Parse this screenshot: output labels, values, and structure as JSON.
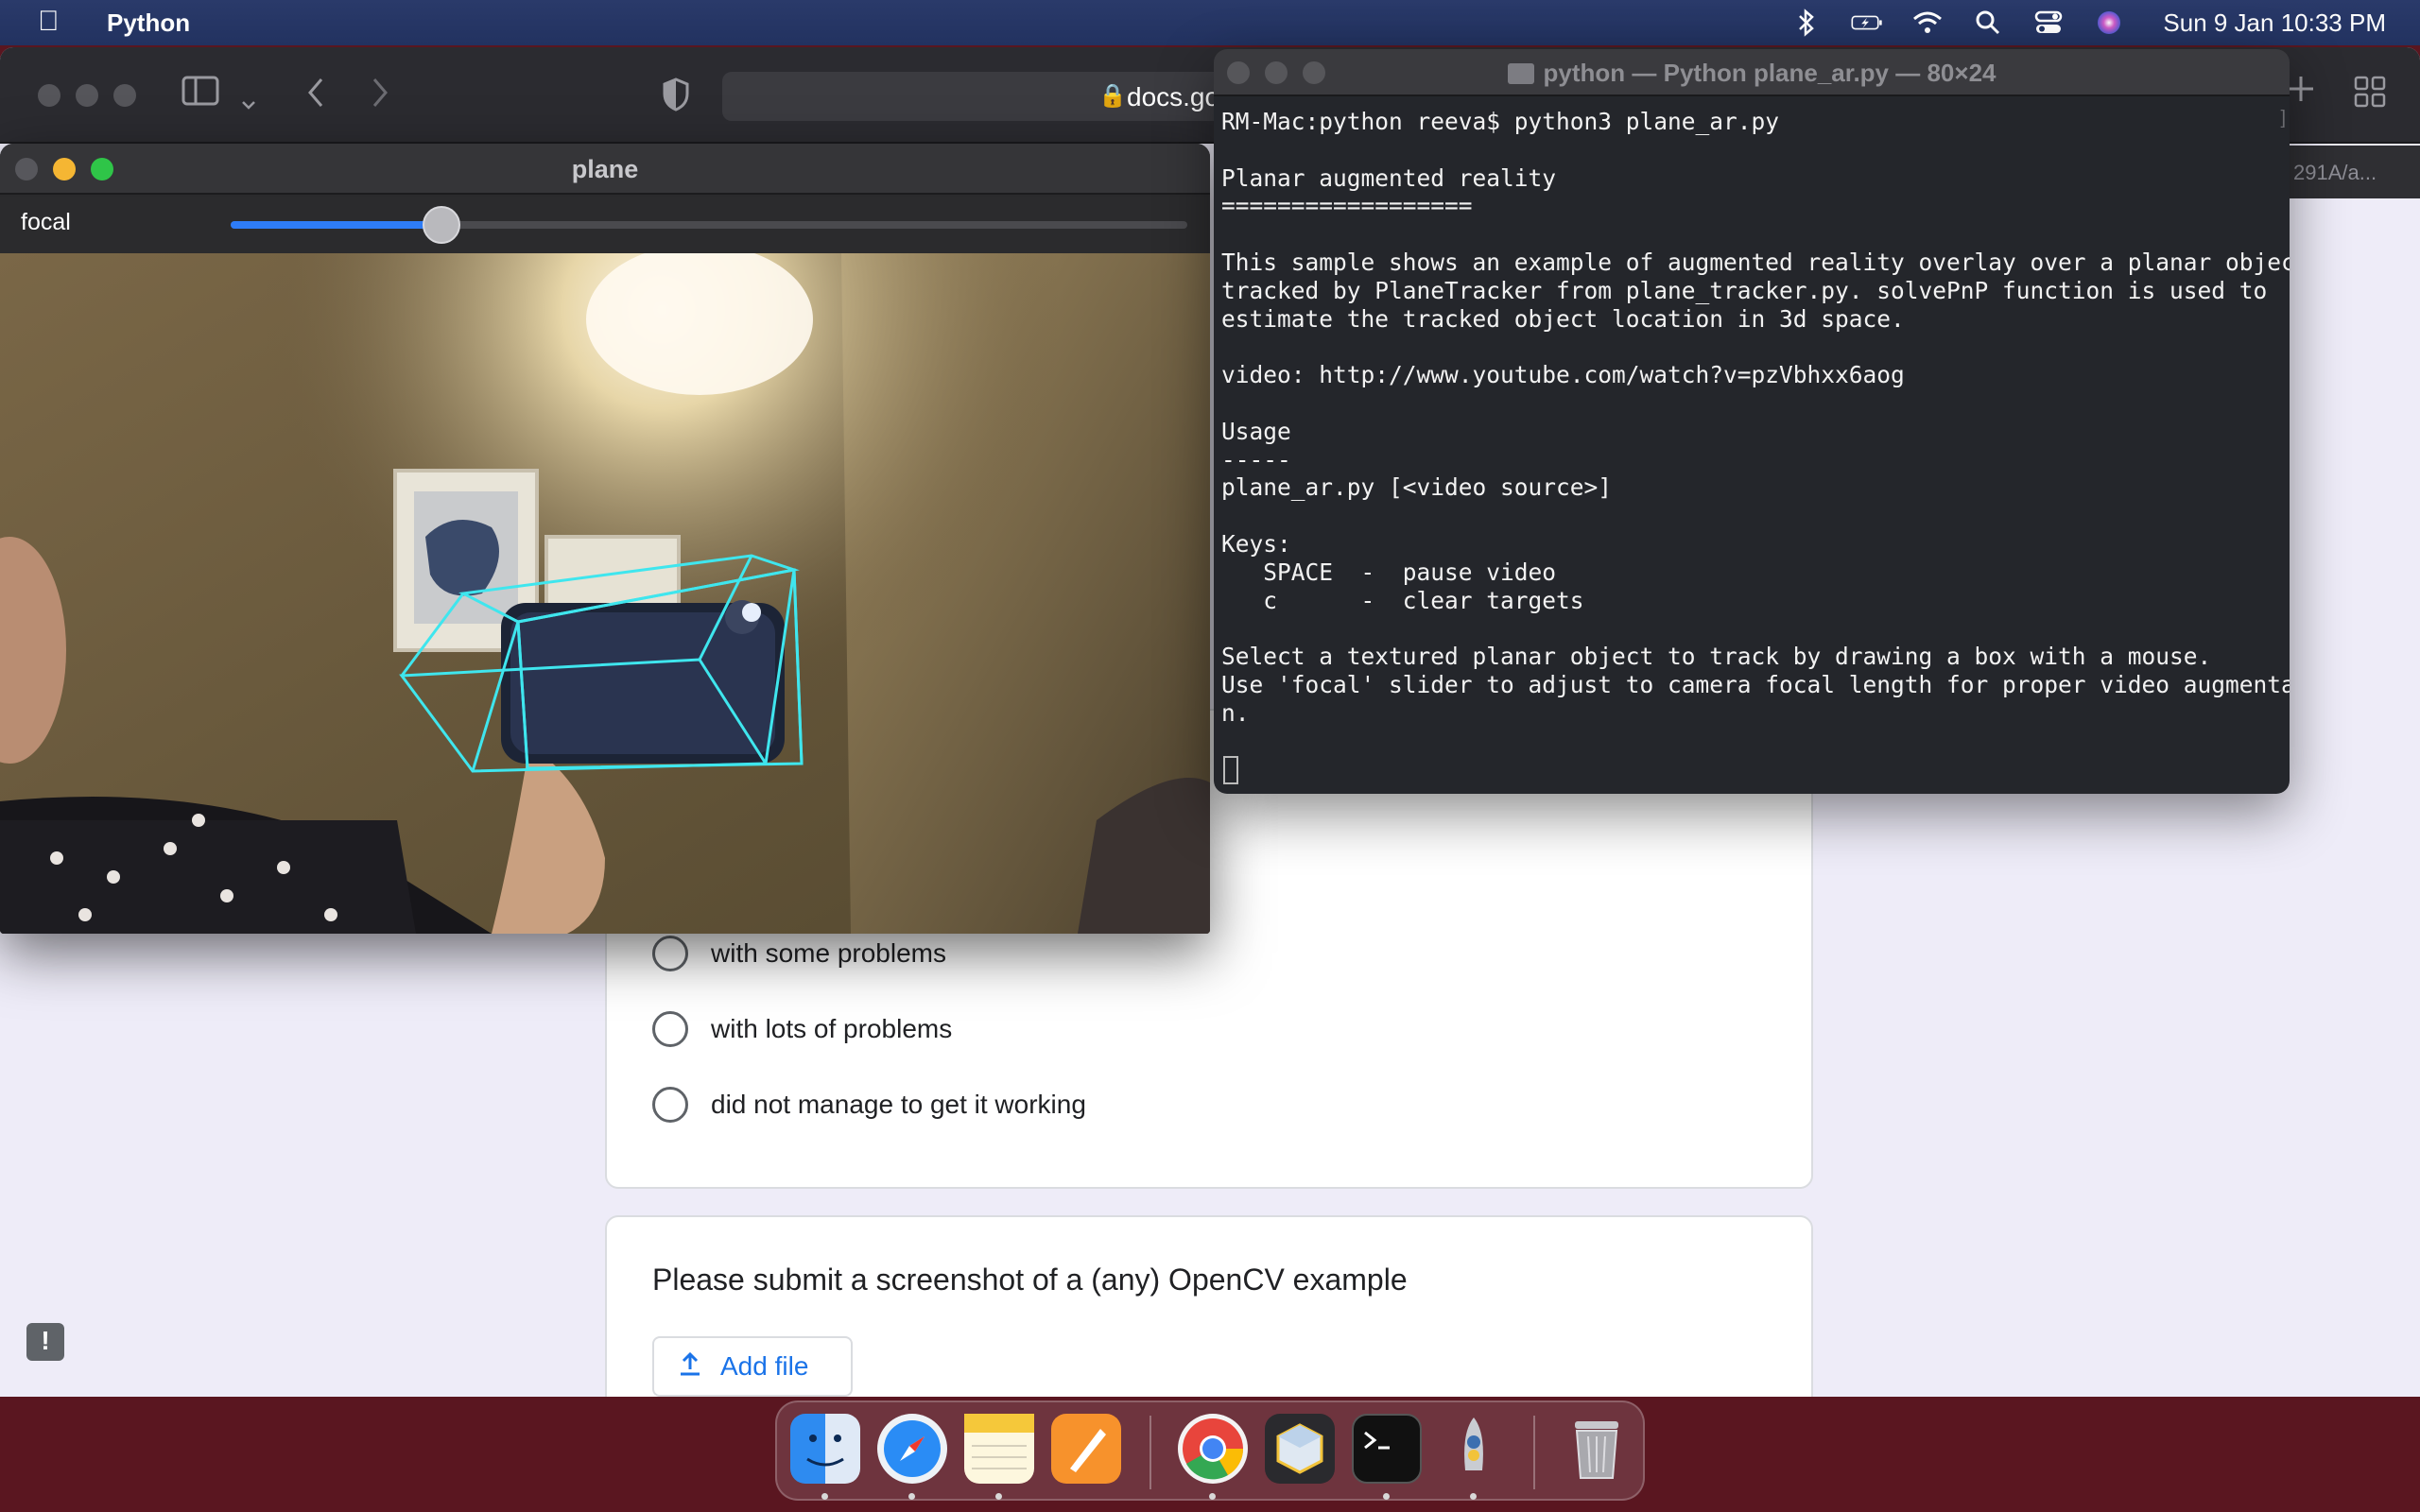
{
  "menubar": {
    "apple_icon": "apple-logo-icon",
    "app_name": "Python",
    "status_icons": [
      "bluetooth-icon",
      "battery-charging-icon",
      "wifi-icon",
      "spotlight-search-icon",
      "control-center-icon",
      "siri-icon"
    ],
    "clock": "Sun 9 Jan  10:33 PM"
  },
  "browser": {
    "url_text": "docs.go",
    "tab_strip_text": "291A/a...",
    "radio_options": [
      {
        "label": "with some problems"
      },
      {
        "label": "with lots of problems"
      },
      {
        "label": "did not manage to get it working"
      }
    ],
    "question_title": "Please submit a screenshot of a (any) OpenCV example",
    "add_file_label": "Add file",
    "feedback_icon": "!"
  },
  "plane_window": {
    "title": "plane",
    "slider_label": "focal",
    "slider_value_fraction": 0.22
  },
  "terminal": {
    "title": "python — Python plane_ar.py — 80×24",
    "lines": [
      "RM-Mac:python reeva$ python3 plane_ar.py",
      "",
      "Planar augmented reality",
      "==================",
      "",
      "This sample shows an example of augmented reality overlay over a planar object",
      "tracked by PlaneTracker from plane_tracker.py. solvePnP function is used to",
      "estimate the tracked object location in 3d space.",
      "",
      "video: http://www.youtube.com/watch?v=pzVbhxx6aog",
      "",
      "Usage",
      "-----",
      "plane_ar.py [<video source>]",
      "",
      "Keys:",
      "   SPACE  -  pause video",
      "   c      -  clear targets",
      "",
      "Select a textured planar object to track by drawing a box with a mouse.",
      "Use 'focal' slider to adjust to camera focal length for proper video augmentatio",
      "n."
    ]
  },
  "dock": {
    "apps": [
      "finder-icon",
      "safari-icon",
      "notes-icon",
      "pages-icon",
      "chrome-icon",
      "preview-app-icon",
      "terminal-icon",
      "python-launcher-icon",
      "trash-icon"
    ]
  },
  "colors": {
    "accent_blue": "#1a73e8",
    "slider_blue": "#2e7cf6",
    "ar_overlay_cyan": "#3fe6ee",
    "desktop": "#5a1620"
  }
}
